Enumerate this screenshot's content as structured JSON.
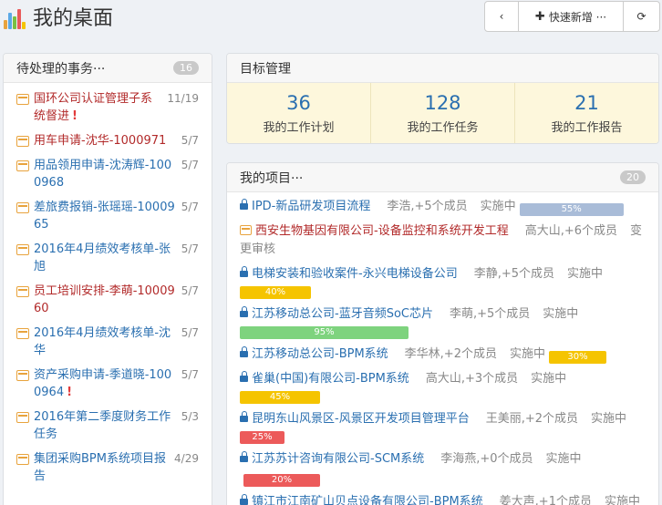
{
  "header": {
    "title": "我的桌面",
    "back_label": "‹",
    "add_label": "快速新增 ···",
    "add_icon": "✚",
    "refresh_icon": "⟳"
  },
  "colors": {
    "accent": "#2a6fb0",
    "todo_red": "#b22a2a",
    "calendar_orange": "#e8a33d",
    "goal_bg": "#fdf7dc"
  },
  "todo": {
    "title": "待处理的事务···",
    "count": "16",
    "items": [
      {
        "text": "国环公司认证管理子系统督进",
        "date": "11/19",
        "color": "red",
        "urgent": true
      },
      {
        "text": "用车申请-沈华-1000971",
        "date": "5/7",
        "color": "red",
        "urgent": false
      },
      {
        "text": "用品领用申请-沈涛辉-1000968",
        "date": "5/7",
        "color": "blue",
        "urgent": false
      },
      {
        "text": "差旅费报销-张瑶瑶-1000965",
        "date": "5/7",
        "color": "blue",
        "urgent": false
      },
      {
        "text": "2016年4月绩效考核单-张旭",
        "date": "5/7",
        "color": "blue",
        "urgent": false
      },
      {
        "text": "员工培训安排-李萌-1000960",
        "date": "5/7",
        "color": "red",
        "urgent": false
      },
      {
        "text": "2016年4月绩效考核单-沈华",
        "date": "5/7",
        "color": "blue",
        "urgent": false
      },
      {
        "text": "资产采购申请-季道晓-1000964",
        "date": "5/7",
        "color": "blue",
        "urgent": true
      },
      {
        "text": "2016年第二季度财务工作任务",
        "date": "5/3",
        "color": "blue",
        "urgent": false
      },
      {
        "text": "集团采购BPM系统项目报告",
        "date": "4/29",
        "color": "blue",
        "urgent": false
      }
    ]
  },
  "goals": {
    "title": "目标管理",
    "cells": [
      {
        "value": "36",
        "label": "我的工作计划"
      },
      {
        "value": "128",
        "label": "我的工作任务"
      },
      {
        "value": "21",
        "label": "我的工作报告"
      }
    ]
  },
  "projects": {
    "title": "我的项目···",
    "count": "20",
    "items": [
      {
        "icon": "lock-icon",
        "name": "IPD-新品研发项目流程",
        "members": "李浩,+5个成员",
        "status": "实施中",
        "progress": 55,
        "bar": "gray",
        "inline": true,
        "red": false
      },
      {
        "icon": "calendar-icon",
        "name": "西安生物基因有限公司-设备监控和系统开发工程",
        "members": "高大山,+6个成员",
        "status": "变更审核",
        "progress": null,
        "bar": null,
        "inline": true,
        "red": true
      },
      {
        "icon": "lock-icon",
        "name": "电梯安装和验收案件-永兴电梯设备公司",
        "members": "李静,+5个成员",
        "status": "实施中",
        "progress": 40,
        "bar": "yellow",
        "inline": false,
        "red": false
      },
      {
        "icon": "lock-icon",
        "name": "江苏移动总公司-蓝牙音频SoC芯片",
        "members": "李萌,+5个成员",
        "status": "实施中",
        "progress": 95,
        "bar": "green",
        "inline": false,
        "red": false
      },
      {
        "icon": "lock-icon",
        "name": "江苏移动总公司-BPM系统",
        "members": "李华林,+2个成员",
        "status": "实施中",
        "progress": 30,
        "bar": "yellow",
        "inline": true,
        "red": false
      },
      {
        "icon": "lock-icon",
        "name": "雀巢(中国)有限公司-BPM系统",
        "members": "高大山,+3个成员",
        "status": "实施中",
        "progress": 45,
        "bar": "yellow",
        "inline": false,
        "red": false
      },
      {
        "icon": "lock-icon",
        "name": "昆明东山风景区-风景区开发项目管理平台",
        "members": "王美丽,+2个成员",
        "status": "实施中",
        "progress": 25,
        "bar": "red",
        "inline": false,
        "red": false
      },
      {
        "icon": "lock-icon",
        "name": "江苏苏计咨询有限公司-SCM系统",
        "members": "李海燕,+0个成员",
        "status": "实施中",
        "progress": 20,
        "bar": "red",
        "inline": true,
        "red": false
      },
      {
        "icon": "lock-icon",
        "name": "镇江市江南矿山贝点设备有限公司-BPM系统",
        "members": "姜大声,+1个成员",
        "status": "实施中",
        "progress": null,
        "bar": null,
        "inline": true,
        "red": false
      }
    ]
  }
}
